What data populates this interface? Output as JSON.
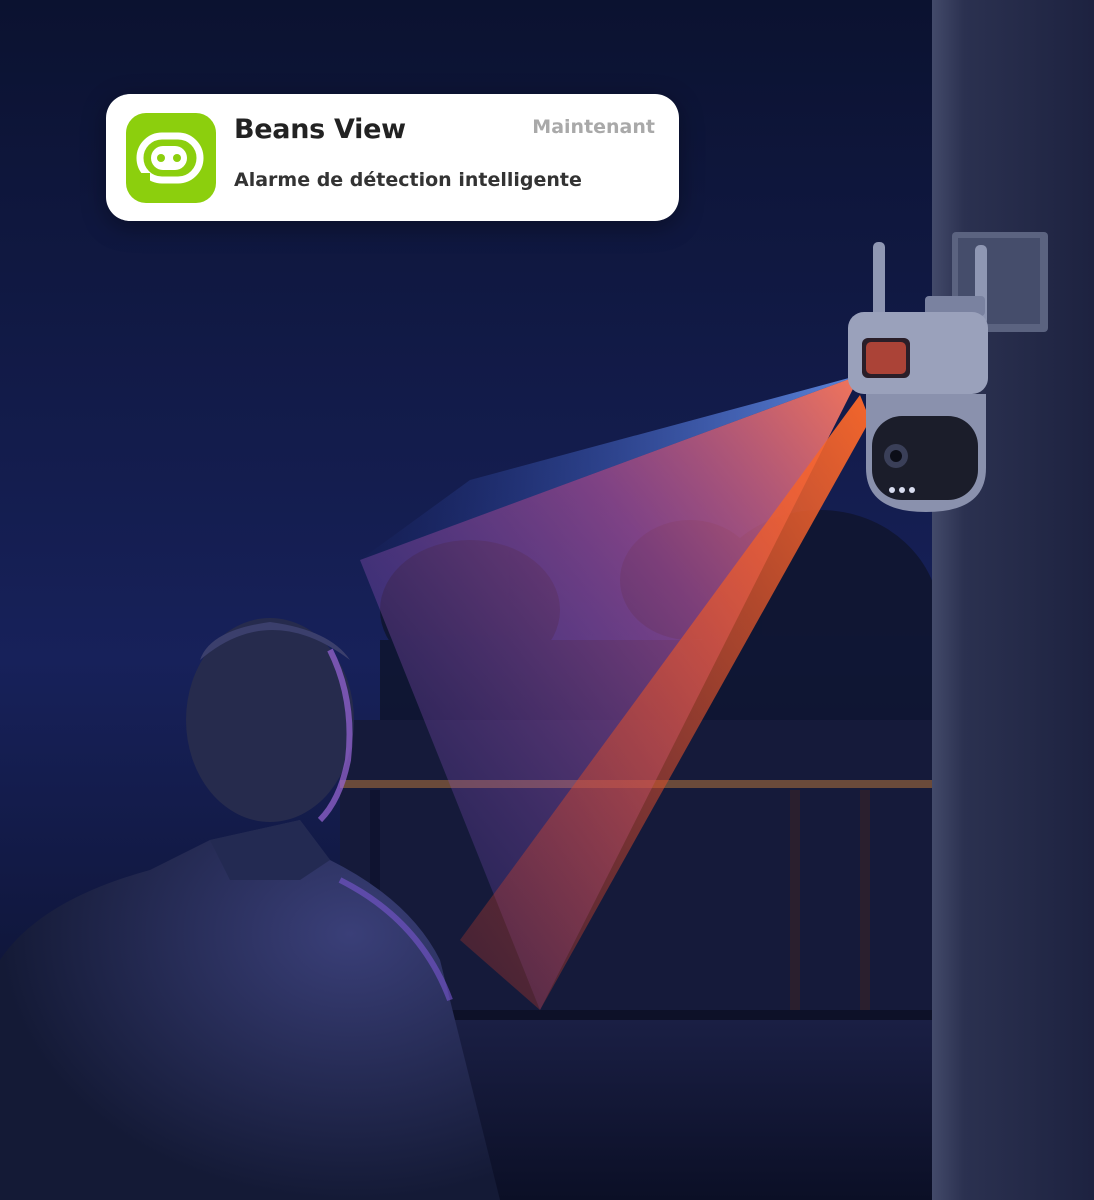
{
  "notification": {
    "app_name": "Beans View",
    "time": "Maintenant",
    "message": "Alarme de détection intelligente",
    "icon": "smiling-face-icon",
    "icon_color": "#8ccf0d"
  },
  "scene": {
    "elements": [
      "night-sky",
      "house-wall",
      "security-camera",
      "camera-light-beam",
      "person-silhouette",
      "trees",
      "porch"
    ],
    "beam_colors": [
      "#3a66ff",
      "#ff5a1f"
    ]
  }
}
